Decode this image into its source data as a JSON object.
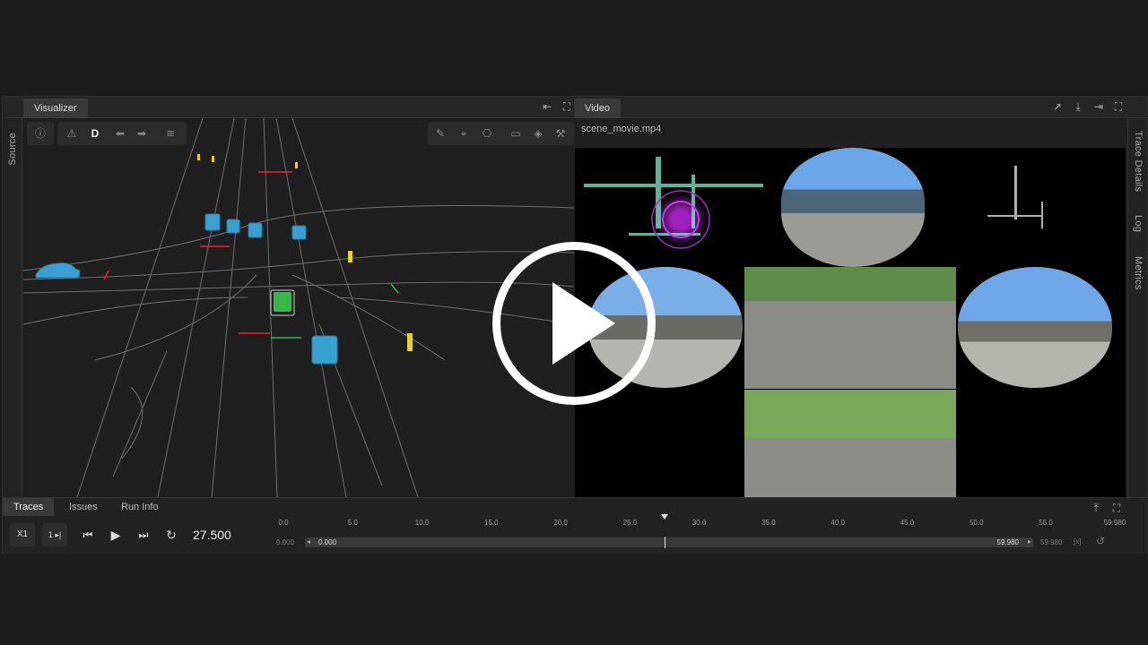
{
  "left_panel": {
    "tab": "Visualizer",
    "source_label": "Source"
  },
  "right_panel": {
    "tab": "Video",
    "filename": "scene_movie.mp4",
    "side_tabs": [
      "Trace Details",
      "Log",
      "Metrics"
    ]
  },
  "viz_toolbar": {
    "mode_letter": "D",
    "icons": [
      "info-icon",
      "warning-icon",
      "arrow-left-icon",
      "arrow-right-icon",
      "lanes-icon",
      "ruler-icon",
      "focus-icon",
      "camera-settings-icon",
      "video-icon",
      "layers-icon",
      "wrench-icon"
    ]
  },
  "bottom_tabs": [
    "Traces",
    "Issues",
    "Run Info"
  ],
  "playback": {
    "speed": "X1",
    "step": "1 ▸|",
    "time": "27.500",
    "current": 27.5,
    "ticks": [
      "0.0",
      "5.0",
      "10.0",
      "15.0",
      "20.0",
      "25.0",
      "30.0",
      "35.0",
      "40.0",
      "45.0",
      "50.0",
      "55.0",
      "59.980"
    ],
    "range_start": "0.000",
    "range_end": "59.980",
    "outer_start": "0.000",
    "outer_end": "59.980",
    "bracket": "[x]"
  },
  "colors": {
    "accent_blue": "#3aa0d0",
    "ego_green": "#39b54a",
    "bg": "#1c1c1c"
  }
}
